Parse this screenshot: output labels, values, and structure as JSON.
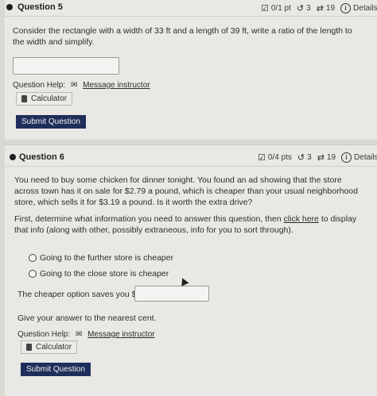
{
  "q5": {
    "title": "Question 5",
    "points": "0/1 pt",
    "retries": "3",
    "submissions": "19",
    "details": "Details",
    "prompt": "Consider the rectangle with a width of 33 ft and a length of 39 ft, write a ratio of the length to the width and simplify.",
    "help_label": "Question Help:",
    "message_label": "Message instructor",
    "calculator_label": "Calculator",
    "submit_label": "Submit Question"
  },
  "q6": {
    "title": "Question 6",
    "points": "0/4 pts",
    "retries": "3",
    "submissions": "19",
    "details": "Details",
    "prompt": "You need to buy some chicken for dinner tonight. You found an ad showing that the store across town has it on sale for $2.79 a pound, which is cheaper than your usual neighborhood store, which sells it for $3.19 a pound. Is it worth the extra drive?",
    "instruction_pre": "First, determine what information you need to answer this question, then",
    "instruction_link": "click here",
    "instruction_post": "to display that info (along with other, possibly extraneous, info for you to sort through).",
    "options": [
      "Going to the further store is cheaper",
      "Going to the close store is cheaper"
    ],
    "savings_label": "The cheaper option saves you $",
    "nearest_cent": "Give your answer to the nearest cent.",
    "help_label": "Question Help:",
    "message_label": "Message instructor",
    "calculator_label": "Calculator",
    "submit_label": "Submit Question"
  },
  "icons": {
    "checkbox": "checkbox-icon",
    "retry": "retry-icon",
    "submissions": "refresh-icon",
    "info": "info-icon",
    "envelope": "envelope-icon",
    "calculator": "calculator-icon"
  },
  "colors": {
    "submit_bg": "#1f2e5a",
    "page_bg": "#e9e8e4"
  }
}
